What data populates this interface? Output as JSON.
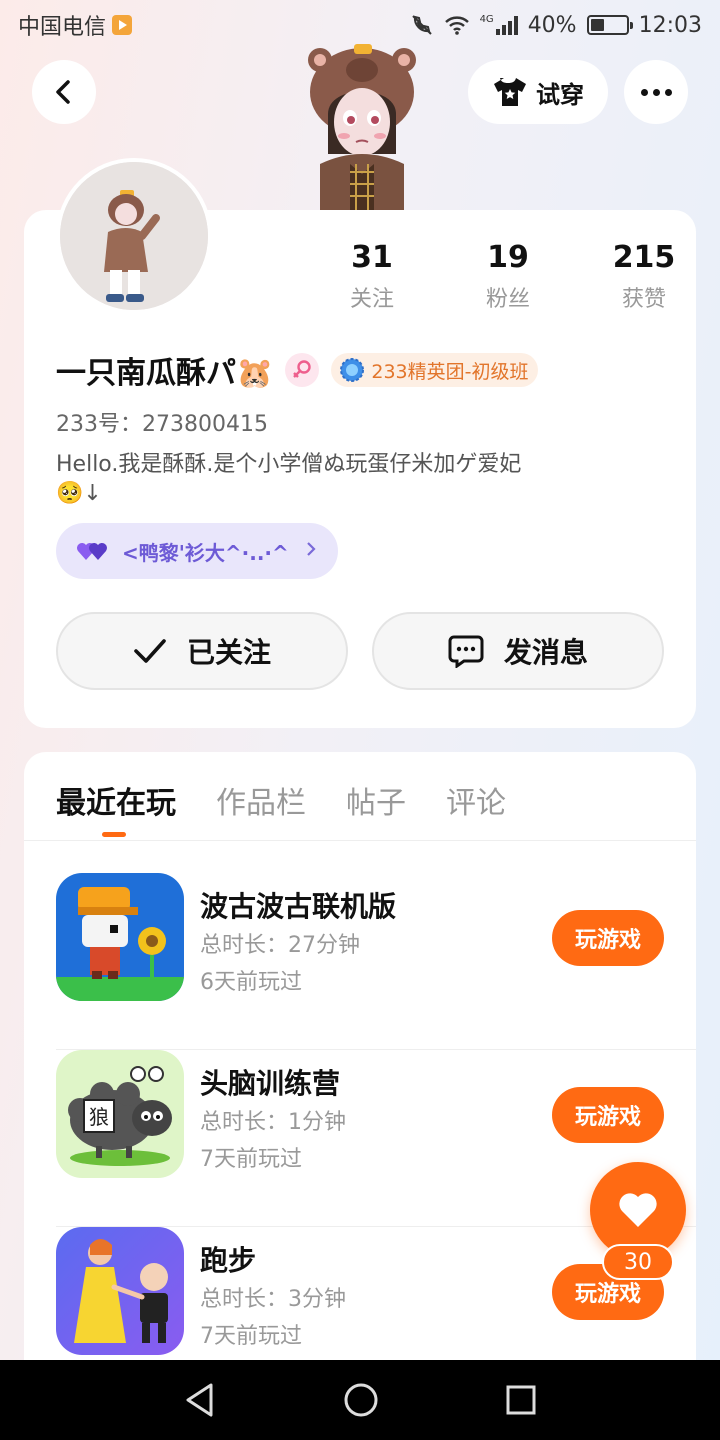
{
  "status_bar": {
    "carrier": "中国电信",
    "network": "4G",
    "battery": "40%",
    "battery_level": 0.4,
    "time": "12:03"
  },
  "top_nav": {
    "back_icon": "chevron-left-icon",
    "try_on_label": "试穿",
    "more_icon": "more-icon"
  },
  "profile": {
    "stats": [
      {
        "value": "31",
        "label": "关注"
      },
      {
        "value": "19",
        "label": "粉丝"
      },
      {
        "value": "215",
        "label": "获赞"
      }
    ],
    "nickname": "一只南瓜酥パ🐹",
    "gender": "female",
    "club_badge": "233精英团-初级班",
    "uid_label": "233号：",
    "uid_value": "273800415",
    "bio": "Hello.我是酥酥.是个小学僧ぬ玩蛋仔米加ゲ爱妃🥺↓",
    "relation": "<鸭黎'衫大^·..·^",
    "follow_label": "已关注",
    "message_label": "发消息"
  },
  "tabs": [
    {
      "label": "最近在玩",
      "active": true
    },
    {
      "label": "作品栏",
      "active": false
    },
    {
      "label": "帖子",
      "active": false
    },
    {
      "label": "评论",
      "active": false
    }
  ],
  "games": [
    {
      "title": "波古波古联机版",
      "duration": "总时长：27分钟",
      "last_played": "6天前玩过",
      "action": "玩游戏"
    },
    {
      "title": "头脑训练营",
      "duration": "总时长：1分钟",
      "last_played": "7天前玩过",
      "action": "玩游戏"
    },
    {
      "title": "跑步",
      "duration": "总时长：3分钟",
      "last_played": "7天前玩过",
      "action": "玩游戏"
    }
  ],
  "fab": {
    "icon": "heart-icon",
    "count": "30"
  },
  "colors": {
    "accent": "#ff6a13",
    "relation_purple": "#6d5ad6",
    "club_orange": "#e2752b"
  }
}
